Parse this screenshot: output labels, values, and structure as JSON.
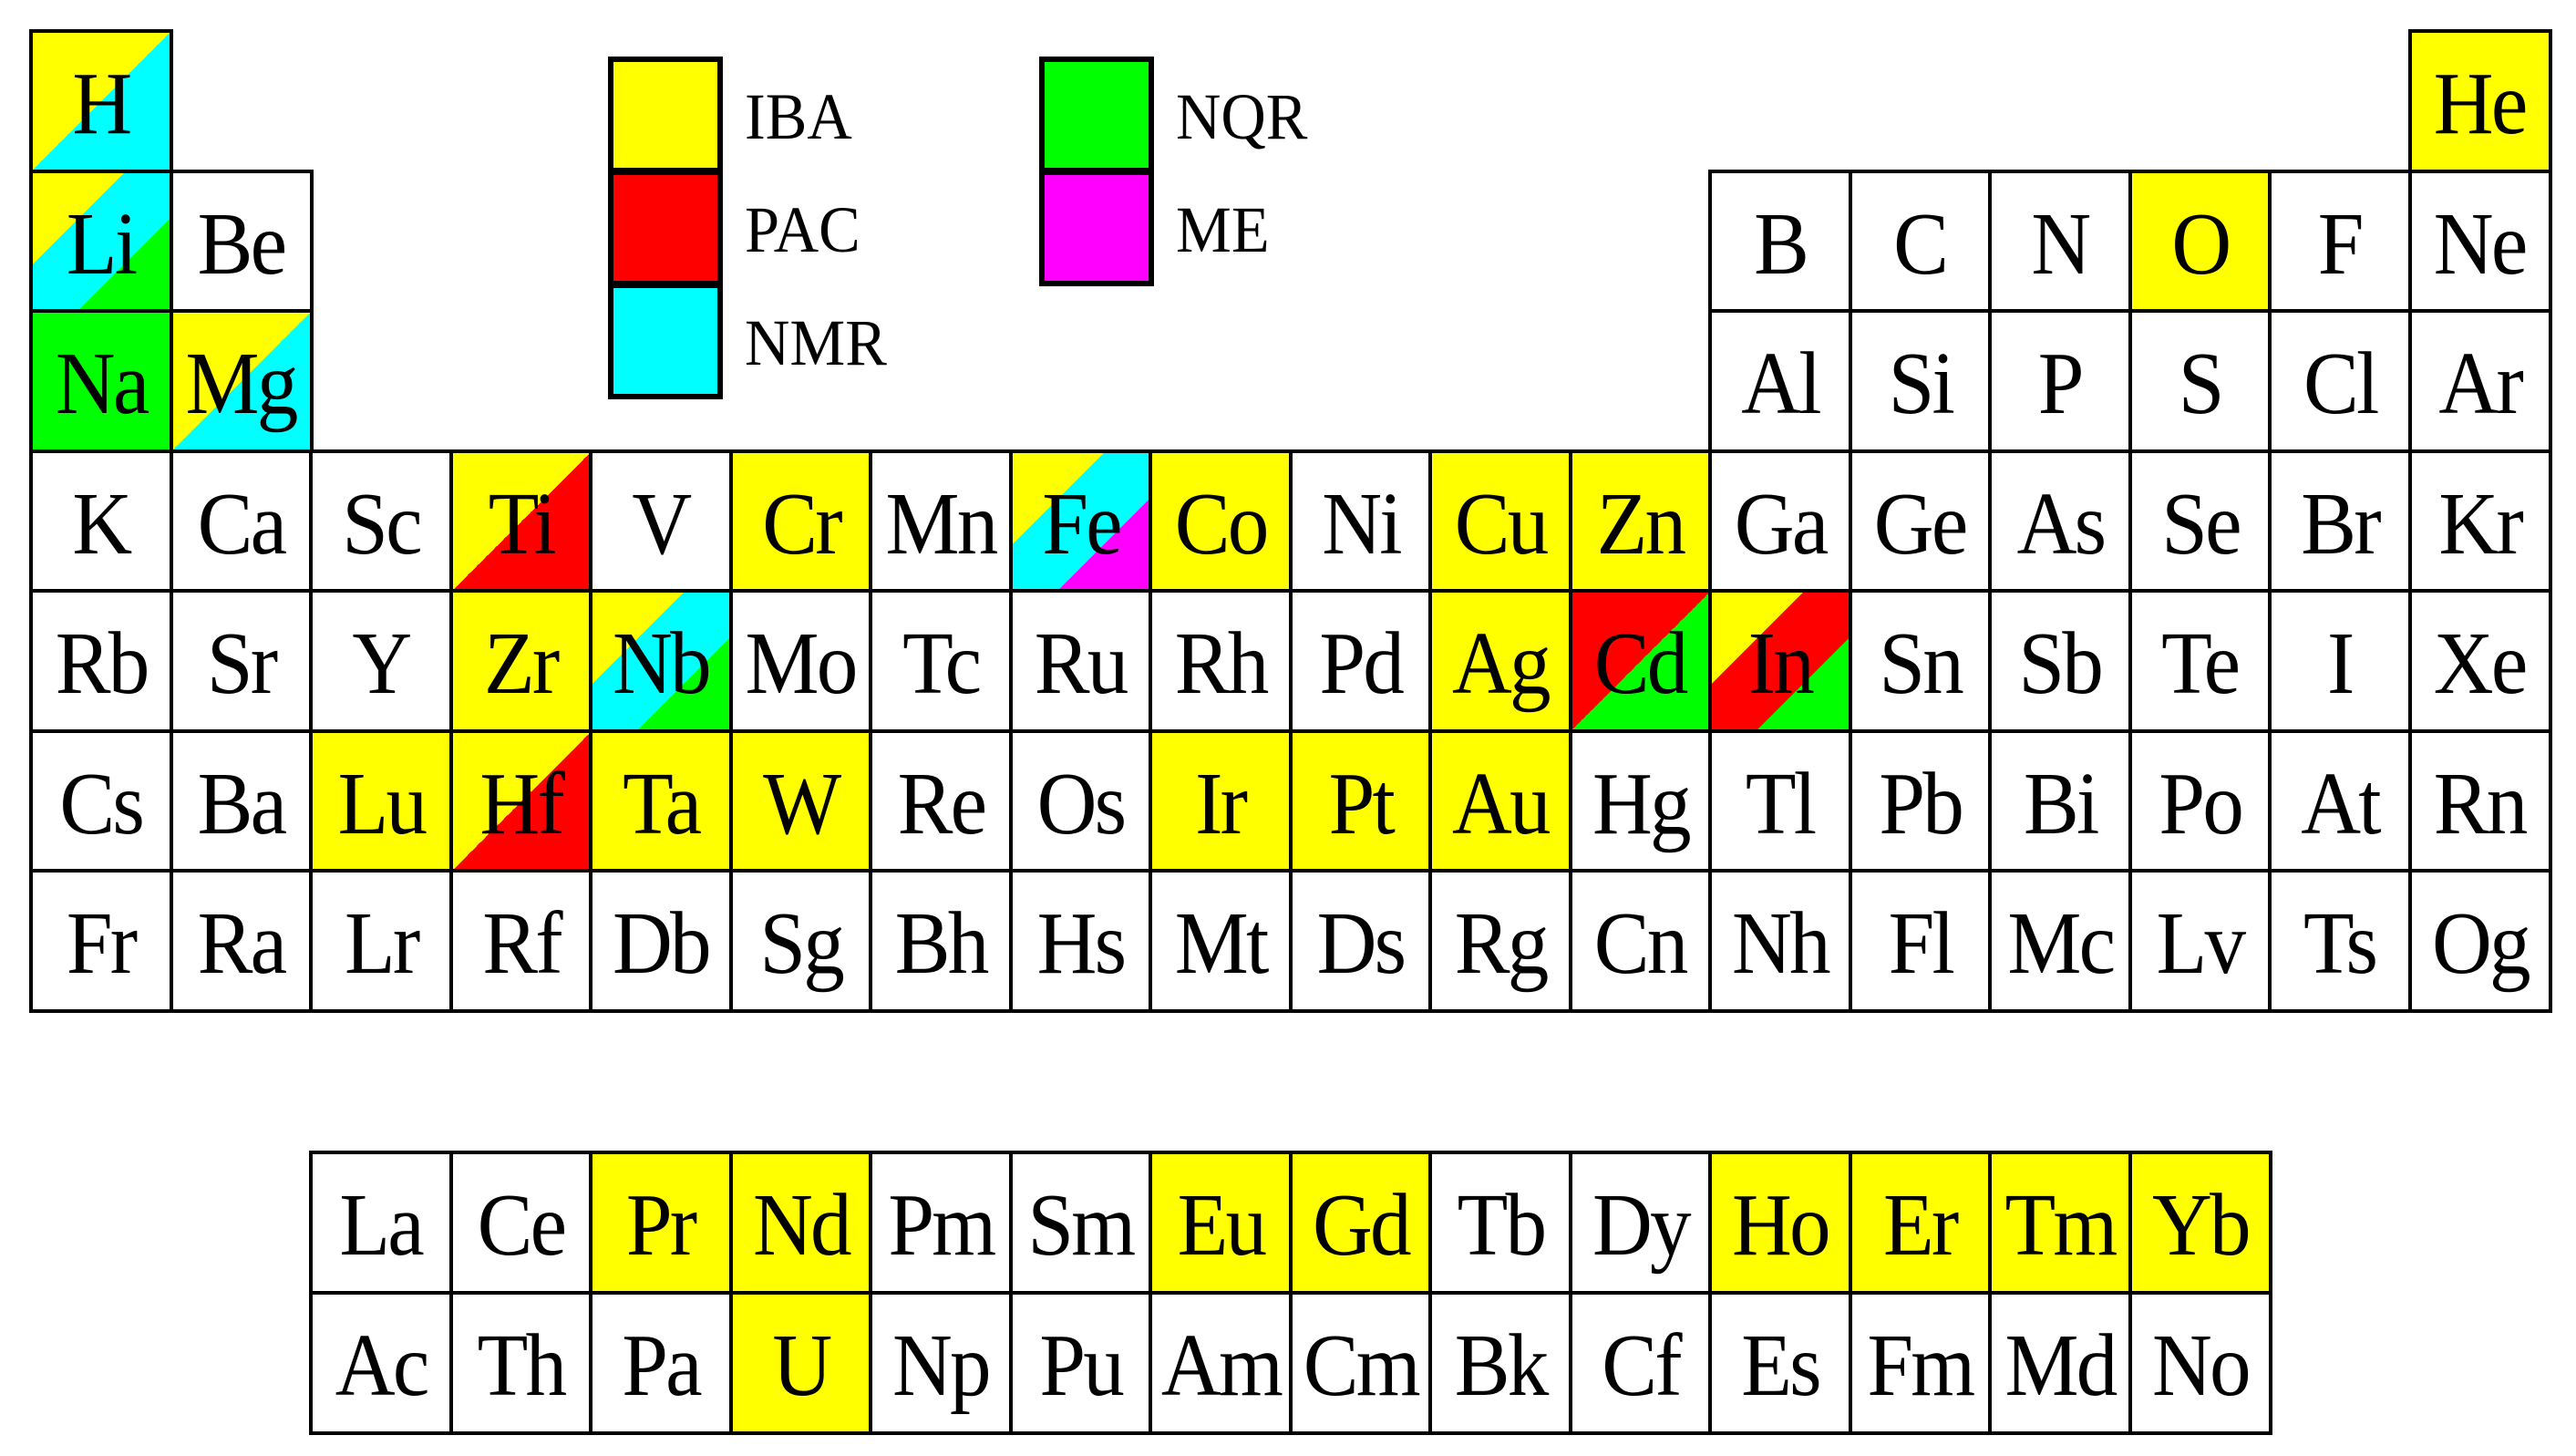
{
  "colors": {
    "IBA": "#ffff00",
    "PAC": "#ff0000",
    "NMR": "#00ffff",
    "NQR": "#00ff00",
    "ME": "#ff00ff"
  },
  "legend": [
    {
      "key": "IBA",
      "label": "IBA"
    },
    {
      "key": "PAC",
      "label": "PAC"
    },
    {
      "key": "NMR",
      "label": "NMR"
    },
    {
      "key": "NQR",
      "label": "NQR"
    },
    {
      "key": "ME",
      "label": "ME"
    }
  ],
  "main_table": [
    [
      "H",
      "",
      "",
      "",
      "",
      "",
      "",
      "",
      "",
      "",
      "",
      "",
      "",
      "",
      "",
      "",
      "",
      "He"
    ],
    [
      "Li",
      "Be",
      "",
      "",
      "",
      "",
      "",
      "",
      "",
      "",
      "",
      "",
      "B",
      "C",
      "N",
      "O",
      "F",
      "Ne"
    ],
    [
      "Na",
      "Mg",
      "",
      "",
      "",
      "",
      "",
      "",
      "",
      "",
      "",
      "",
      "Al",
      "Si",
      "P",
      "S",
      "Cl",
      "Ar"
    ],
    [
      "K",
      "Ca",
      "Sc",
      "Ti",
      "V",
      "Cr",
      "Mn",
      "Fe",
      "Co",
      "Ni",
      "Cu",
      "Zn",
      "Ga",
      "Ge",
      "As",
      "Se",
      "Br",
      "Kr"
    ],
    [
      "Rb",
      "Sr",
      "Y",
      "Zr",
      "Nb",
      "Mo",
      "Tc",
      "Ru",
      "Rh",
      "Pd",
      "Ag",
      "Cd",
      "In",
      "Sn",
      "Sb",
      "Te",
      "I",
      "Xe"
    ],
    [
      "Cs",
      "Ba",
      "Lu",
      "Hf",
      "Ta",
      "W",
      "Re",
      "Os",
      "Ir",
      "Pt",
      "Au",
      "Hg",
      "Tl",
      "Pb",
      "Bi",
      "Po",
      "At",
      "Rn"
    ],
    [
      "Fr",
      "Ra",
      "Lr",
      "Rf",
      "Db",
      "Sg",
      "Bh",
      "Hs",
      "Mt",
      "Ds",
      "Rg",
      "Cn",
      "Nh",
      "Fl",
      "Mc",
      "Lv",
      "Ts",
      "Og"
    ]
  ],
  "f_block": [
    [
      "La",
      "Ce",
      "Pr",
      "Nd",
      "Pm",
      "Sm",
      "Eu",
      "Gd",
      "Tb",
      "Dy",
      "Ho",
      "Er",
      "Tm",
      "Yb"
    ],
    [
      "Ac",
      "Th",
      "Pa",
      "U",
      "Np",
      "Pu",
      "Am",
      "Cm",
      "Bk",
      "Cf",
      "Es",
      "Fm",
      "Md",
      "No"
    ]
  ],
  "techniques": {
    "H": [
      "IBA",
      "NMR"
    ],
    "He": [
      "IBA"
    ],
    "Li": [
      "IBA",
      "NMR",
      "NQR"
    ],
    "O": [
      "IBA"
    ],
    "Na": [
      "NQR"
    ],
    "Mg": [
      "IBA",
      "NMR"
    ],
    "Ti": [
      "IBA",
      "PAC"
    ],
    "Cr": [
      "IBA"
    ],
    "Fe": [
      "IBA",
      "NMR",
      "ME"
    ],
    "Co": [
      "IBA"
    ],
    "Cu": [
      "IBA"
    ],
    "Zn": [
      "IBA"
    ],
    "Zr": [
      "IBA"
    ],
    "Nb": [
      "IBA",
      "NMR",
      "NQR"
    ],
    "Ag": [
      "IBA"
    ],
    "Cd": [
      "PAC",
      "NQR"
    ],
    "In": [
      "IBA",
      "PAC",
      "NQR"
    ],
    "Lu": [
      "IBA"
    ],
    "Hf": [
      "IBA",
      "PAC"
    ],
    "Ta": [
      "IBA"
    ],
    "W": [
      "IBA"
    ],
    "Ir": [
      "IBA"
    ],
    "Pt": [
      "IBA"
    ],
    "Au": [
      "IBA"
    ],
    "Pr": [
      "IBA"
    ],
    "Nd": [
      "IBA"
    ],
    "Eu": [
      "IBA"
    ],
    "Gd": [
      "IBA"
    ],
    "Ho": [
      "IBA"
    ],
    "Er": [
      "IBA"
    ],
    "Tm": [
      "IBA"
    ],
    "Yb": [
      "IBA"
    ],
    "U": [
      "IBA"
    ]
  }
}
